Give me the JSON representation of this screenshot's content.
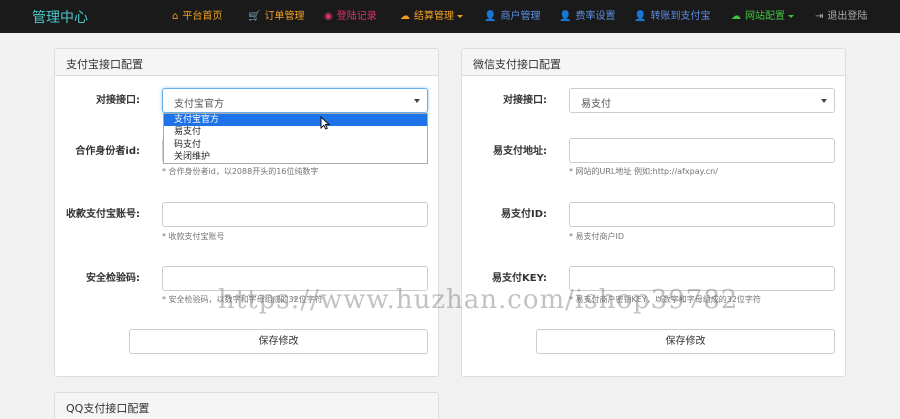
{
  "navbar": {
    "brand": "管理中心",
    "items": [
      {
        "label": "平台首页",
        "icon": "home-icon",
        "color": "#f0a020",
        "dropdown": false
      },
      {
        "label": "订单管理",
        "icon": "cart-icon",
        "color": "#f0a020",
        "dropdown": false
      },
      {
        "label": "登陆记录",
        "icon": "camera-icon",
        "color": "#e0336a",
        "dropdown": false
      },
      {
        "label": "结算管理",
        "icon": "cloud-icon",
        "color": "#f0a020",
        "dropdown": true
      },
      {
        "label": "商户管理",
        "icon": "user-icon",
        "color": "#5b8ee6",
        "dropdown": false
      },
      {
        "label": "费率设置",
        "icon": "user-icon",
        "color": "#5b8ee6",
        "dropdown": false
      },
      {
        "label": "转账到支付宝",
        "icon": "user-icon",
        "color": "#5b8ee6",
        "dropdown": false
      },
      {
        "label": "网站配置",
        "icon": "cloud-icon",
        "color": "#3fc43f",
        "dropdown": true
      },
      {
        "label": "退出登陆",
        "icon": "logout-icon",
        "color": "#aaaaaa",
        "dropdown": false
      }
    ]
  },
  "alipay": {
    "title": "支付宝接口配置",
    "interface_label": "对接接口:",
    "interface_value": "支付宝官方",
    "interface_options": [
      "支付宝官方",
      "易支付",
      "码支付",
      "关闭维护"
    ],
    "partner_label": "合作身份者id:",
    "partner_help": "* 合作身份者id，以2088开头的16位纯数字",
    "account_label": "收款支付宝账号:",
    "account_help": "* 收款支付宝账号",
    "key_label": "安全检验码:",
    "key_help": "* 安全检验码，以数字和字母组成的32位字符",
    "save": "保存修改"
  },
  "wechat": {
    "title": "微信支付接口配置",
    "interface_label": "对接接口:",
    "interface_value": "易支付",
    "url_label": "易支付地址:",
    "url_help": "* 网站的URL地址 例如:http://afxpay.cn/",
    "id_label": "易支付ID:",
    "id_help": "* 易支付商户ID",
    "key_label": "易支付KEY:",
    "key_help": "* 易支付商户密钥KEY，以数字和字母组成的32位字符",
    "save": "保存修改"
  },
  "qq": {
    "title": "QQ支付接口配置"
  },
  "watermark": "https://www.huzhan.com/ishop39782"
}
